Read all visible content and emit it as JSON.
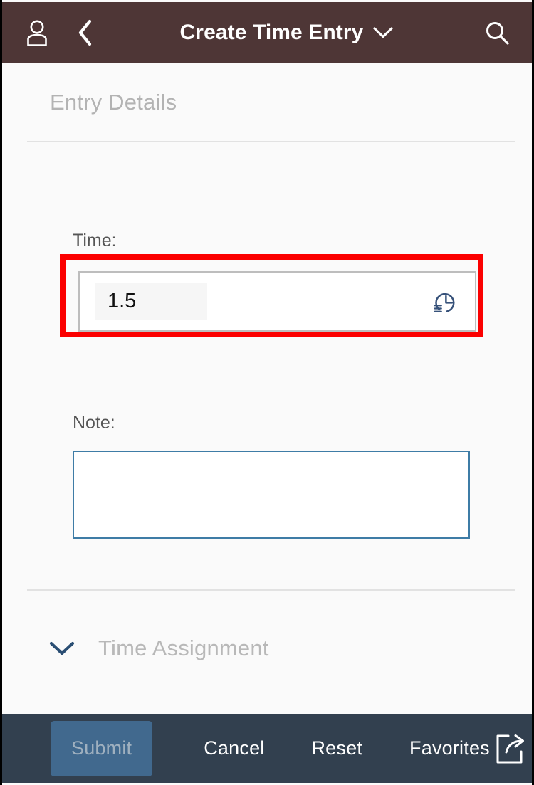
{
  "header": {
    "title": "Create Time Entry",
    "user_icon": "user-icon",
    "back_icon": "chevron-left-icon",
    "dropdown_icon": "chevron-down-icon",
    "search_icon": "search-icon",
    "background_color": "#4e3636"
  },
  "main": {
    "section_title": "Entry Details",
    "time": {
      "label": "Time:",
      "value": "1.5",
      "placeholder": "",
      "icon": "time-record-clock-icon",
      "highlight_color": "#fb0000"
    },
    "note": {
      "label": "Note:",
      "value": "",
      "placeholder": ""
    },
    "time_assignment": {
      "label": "Time Assignment",
      "expand_icon": "chevron-down-icon",
      "expanded": false
    }
  },
  "footer": {
    "submit_label": "Submit",
    "cancel_label": "Cancel",
    "reset_label": "Reset",
    "favorites_label": "Favorites",
    "share_icon": "share-export-icon",
    "background_color": "#32404f",
    "submit_color": "#41698e"
  }
}
